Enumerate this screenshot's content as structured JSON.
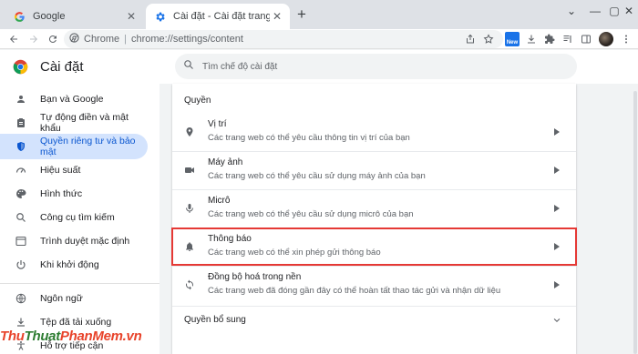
{
  "tabs": [
    {
      "title": "Google",
      "active": false
    },
    {
      "title": "Cài đặt - Cài đặt trang web",
      "active": true
    }
  ],
  "omnibox": {
    "site": "Chrome",
    "url": "chrome://settings/content"
  },
  "new_badge": "New",
  "header": {
    "title": "Cài đặt",
    "search_placeholder": "Tìm chế độ cài đặt"
  },
  "sidebar": {
    "items": [
      {
        "label": "Bạn và Google",
        "icon": "person-icon"
      },
      {
        "label": "Tự động điền và mật khẩu",
        "icon": "clipboard-icon"
      },
      {
        "label": "Quyền riêng tư và bảo mật",
        "icon": "shield-icon",
        "active": true
      },
      {
        "label": "Hiệu suất",
        "icon": "speedometer-icon"
      },
      {
        "label": "Hình thức",
        "icon": "palette-icon"
      },
      {
        "label": "Công cụ tìm kiếm",
        "icon": "search-icon"
      },
      {
        "label": "Trình duyệt mặc định",
        "icon": "browser-icon"
      },
      {
        "label": "Khi khởi động",
        "icon": "power-icon"
      },
      {
        "label": "Ngôn ngữ",
        "icon": "globe-icon"
      },
      {
        "label": "Tệp đã tải xuống",
        "icon": "download-icon"
      },
      {
        "label": "Hỗ trợ tiếp cận",
        "icon": "accessibility-icon"
      }
    ]
  },
  "main": {
    "section_title": "Quyền",
    "rows": [
      {
        "title": "Vị trí",
        "subtitle": "Các trang web có thể yêu cầu thông tin vị trí của bạn",
        "icon": "location-icon"
      },
      {
        "title": "Máy ảnh",
        "subtitle": "Các trang web có thể yêu cầu sử dụng máy ảnh của bạn",
        "icon": "camera-icon"
      },
      {
        "title": "Micrô",
        "subtitle": "Các trang web có thể yêu cầu sử dụng micrô của bạn",
        "icon": "microphone-icon"
      },
      {
        "title": "Thông báo",
        "subtitle": "Các trang web có thể xin phép gửi thông báo",
        "icon": "bell-icon",
        "highlighted": true
      },
      {
        "title": "Đồng bộ hoá trong nền",
        "subtitle": "Các trang web đã đóng gần đây có thể hoàn tất thao tác gửi và nhận dữ liệu",
        "icon": "sync-icon"
      }
    ],
    "extra_section": "Quyền bổ sung"
  },
  "watermark": {
    "part1": "Thu",
    "part2": "Thuat",
    "part3": "PhanMem",
    "part4": ".vn"
  },
  "colors": {
    "accent": "#0b57d0",
    "active_bg": "#d3e3fd",
    "highlight": "#e53935"
  }
}
